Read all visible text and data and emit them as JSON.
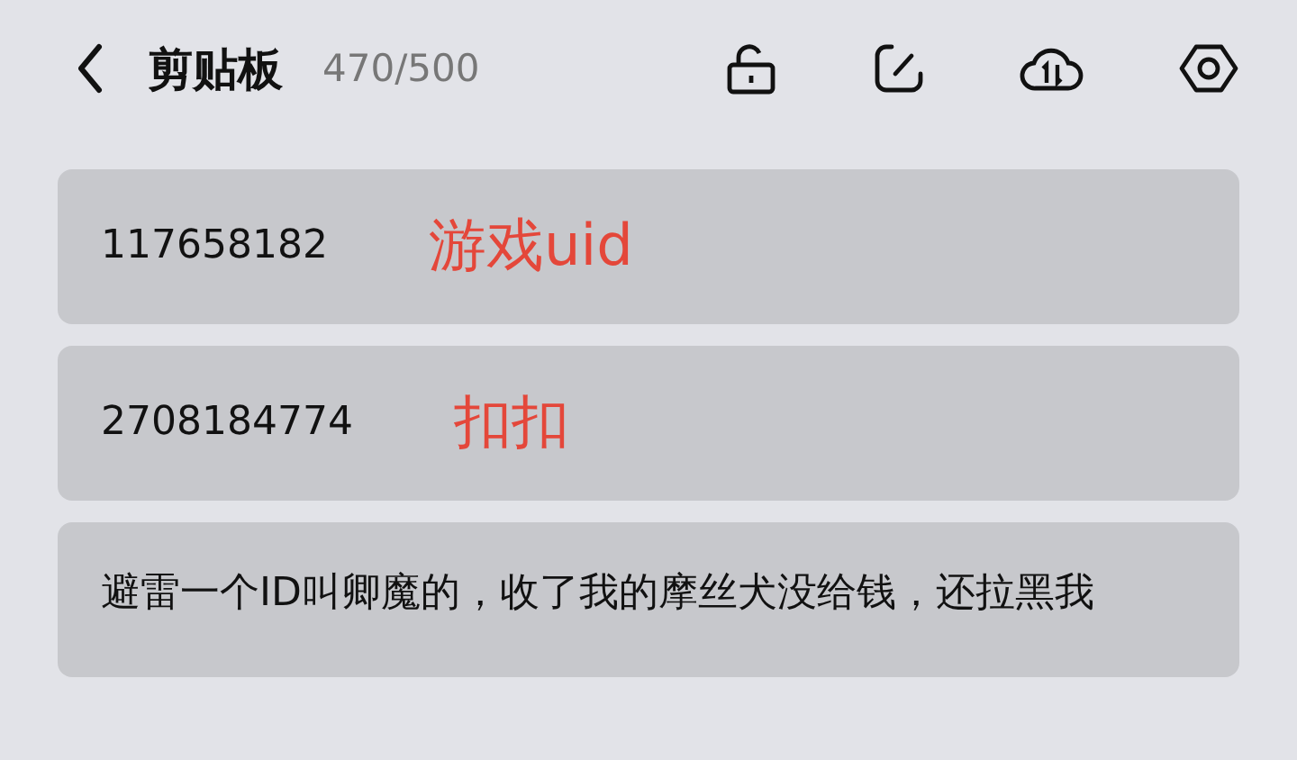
{
  "header": {
    "title": "剪贴板",
    "count": "470/500"
  },
  "items": [
    {
      "text": "117658182",
      "note": "游戏uid"
    },
    {
      "text": "2708184774",
      "note": "扣扣"
    },
    {
      "text": "避雷一个ID叫卿魔的，收了我的摩丝犬没给钱，还拉黑我"
    }
  ]
}
